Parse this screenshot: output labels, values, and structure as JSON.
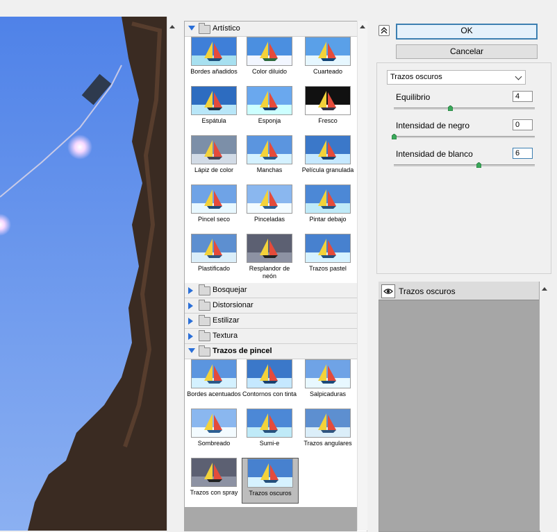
{
  "gallery": {
    "categories": {
      "artistico": {
        "label": "Artístico",
        "expanded": true
      },
      "bosquejar": {
        "label": "Bosquejar"
      },
      "distorsionar": {
        "label": "Distorsionar"
      },
      "estilizar": {
        "label": "Estilizar"
      },
      "textura": {
        "label": "Textura"
      },
      "trazos": {
        "label": "Trazos de pincel",
        "expanded": true
      }
    },
    "artistico_filters": [
      "Bordes añadidos",
      "Color diluido",
      "Cuarteado",
      "Espátula",
      "Esponja",
      "Fresco",
      "Lápiz de color",
      "Manchas",
      "Película granulada",
      "Pincel seco",
      "Pinceladas",
      "Pintar debajo",
      "Plastificado",
      "Resplandor de neón",
      "Trazos pastel"
    ],
    "trazos_filters": [
      "Bordes acentuados",
      "Contornos con tinta",
      "Salpicaduras",
      "Sombreado",
      "Sumi-e",
      "Trazos angulares",
      "Trazos con spray",
      "Trazos oscuros"
    ],
    "selected_filter": "Trazos oscuros"
  },
  "buttons": {
    "ok": "OK",
    "cancel": "Cancelar"
  },
  "settings": {
    "filter_select": "Trazos oscuros",
    "params": [
      {
        "label": "Equilibrio",
        "value": "4",
        "slider_fraction": 0.4
      },
      {
        "label": "Intensidad de negro",
        "value": "0",
        "slider_fraction": 0.0
      },
      {
        "label": "Intensidad de blanco",
        "value": "6",
        "slider_fraction": 0.6
      }
    ]
  },
  "layers": {
    "items": [
      {
        "name": "Trazos oscuros",
        "visible": true
      }
    ]
  },
  "colors": {
    "accent": "#2a6fd8",
    "sky": "#6f9ff0",
    "selection": "#3c7fb1"
  }
}
